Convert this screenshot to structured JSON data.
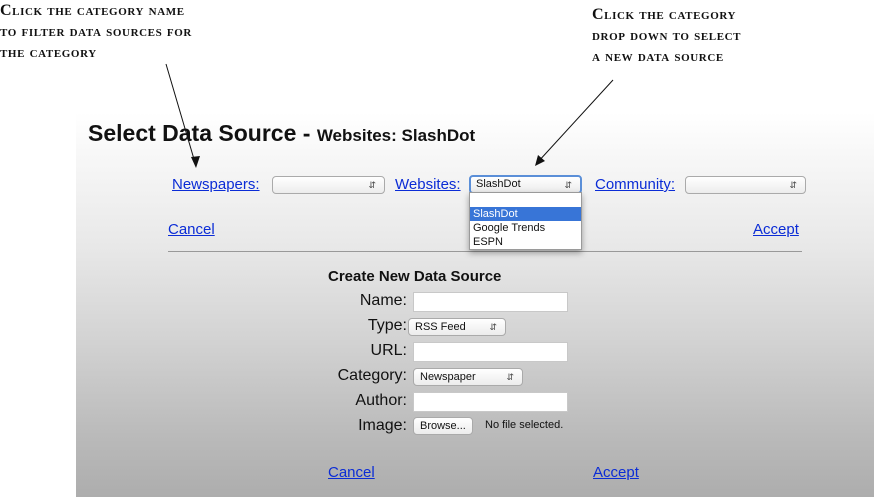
{
  "annotations": {
    "left": [
      "Click the category name",
      "to filter data sources for",
      "the category"
    ],
    "right": [
      "Click the category",
      "drop down to select",
      "a new data source"
    ]
  },
  "panel": {
    "title_main": "Select Data Source - ",
    "title_sub": "Websites: SlashDot",
    "categories": [
      {
        "label": "Newspapers:",
        "selected": ""
      },
      {
        "label": "Websites:",
        "selected": "SlashDot"
      },
      {
        "label": "Community:",
        "selected": ""
      }
    ],
    "dropdown_options": [
      "SlashDot",
      "Google Trends",
      "ESPN"
    ],
    "cancel_top": "Cancel",
    "accept_top": "Accept",
    "form": {
      "heading": "Create New Data Source",
      "name_label": "Name:",
      "type_label": "Type:",
      "type_value": "RSS Feed",
      "url_label": "URL:",
      "category_label": "Category:",
      "category_value": "Newspaper",
      "author_label": "Author:",
      "image_label": "Image:",
      "browse_label": "Browse...",
      "no_file": "No file selected."
    },
    "cancel_bottom": "Cancel",
    "accept_bottom": "Accept"
  },
  "colors": {
    "link": "#0b2cd6",
    "selected_option": "#3875d7",
    "focus_ring": "#5b8fd8"
  }
}
